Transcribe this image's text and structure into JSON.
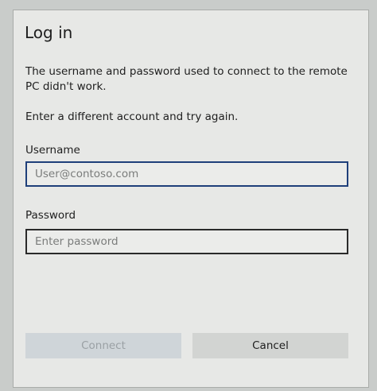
{
  "dialog": {
    "title": "Log in",
    "message": "The username and password used to connect to the remote PC didn't work.",
    "instruction": "Enter a different account and try again."
  },
  "username": {
    "label": "Username",
    "placeholder": "User@contoso.com",
    "value": ""
  },
  "password": {
    "label": "Password",
    "placeholder": "Enter password",
    "value": ""
  },
  "buttons": {
    "connect_label": "Connect",
    "connect_enabled": false,
    "cancel_label": "Cancel"
  },
  "colors": {
    "focus_border": "#1e3f7a",
    "disabled_text": "#9aa0a4"
  }
}
